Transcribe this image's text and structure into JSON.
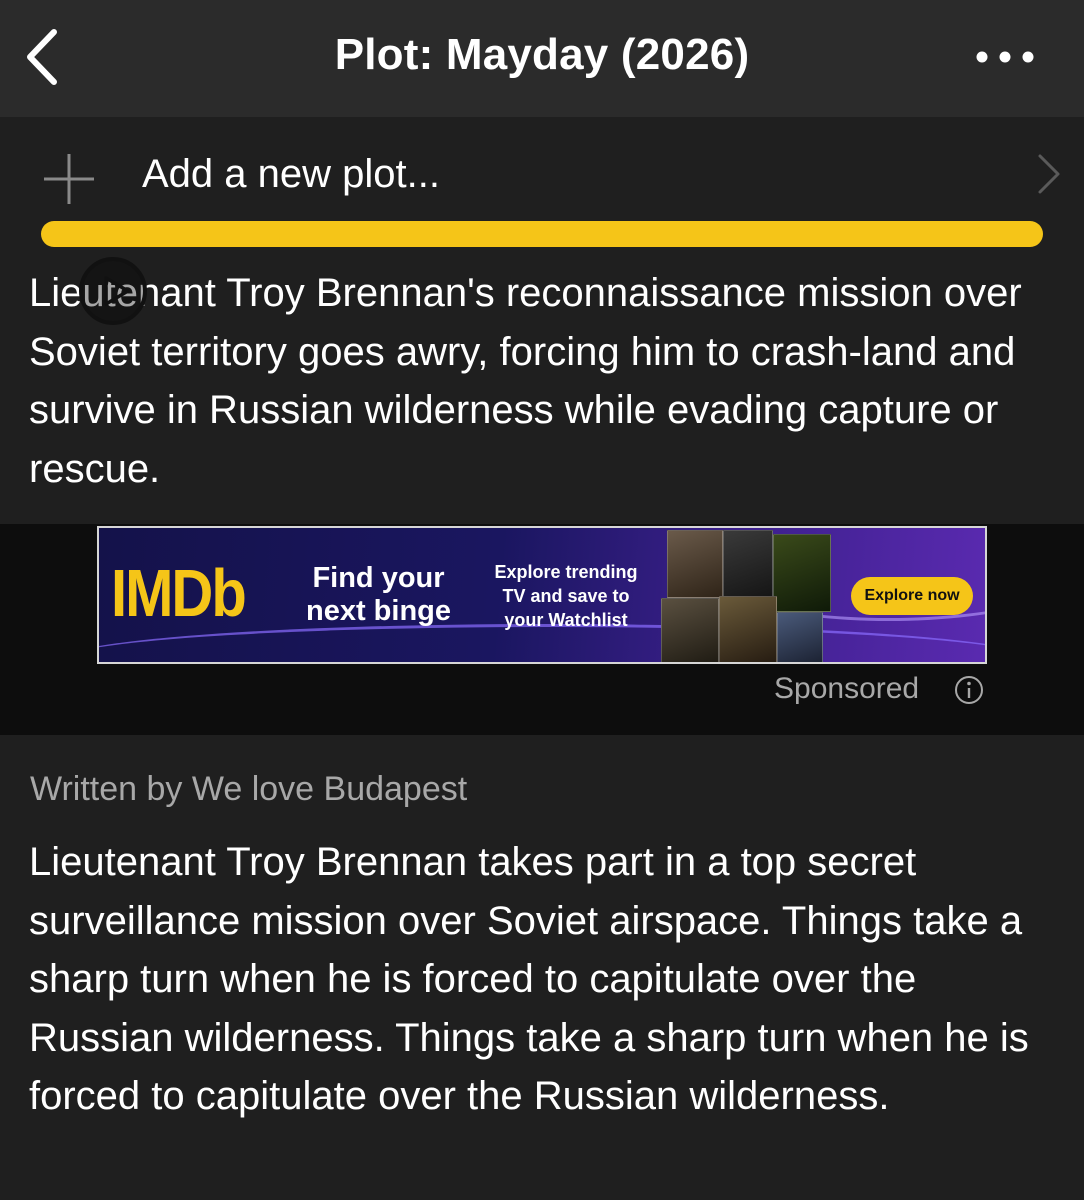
{
  "header": {
    "title": "Plot: Mayday (2026)",
    "back_icon": "chevron-left-icon",
    "more_icon": "more-horizontal-icon"
  },
  "add_plot": {
    "label": "Add a new plot...",
    "icon": "plus-icon",
    "arrow_icon": "chevron-right-icon"
  },
  "summary": {
    "text": "Lieutenant Troy Brennan's reconnaissance mission over Soviet territory goes awry, forcing him to crash-land and survive in Russian wilderness while evading capture or rescue."
  },
  "ad": {
    "logo": "IMDb",
    "headline": "Find your next binge",
    "subtext": "Explore trending TV and save to your Watchlist",
    "cta": "Explore now",
    "sponsored_label": "Sponsored",
    "info_icon": "info-icon"
  },
  "plot": {
    "author": "Written by We love Budapest",
    "text": "Lieutenant Troy Brennan takes part in a top secret surveillance mission over Soviet airspace. Things take a sharp turn when he is forced to capitulate over the Russian wilderness. Things take a sharp turn when he is forced to capitulate over the Russian wilderness."
  },
  "colors": {
    "accent": "#f5c518",
    "background": "#1f1f1f",
    "header_background": "#2b2b2b",
    "muted_text": "#a8a8a8"
  }
}
